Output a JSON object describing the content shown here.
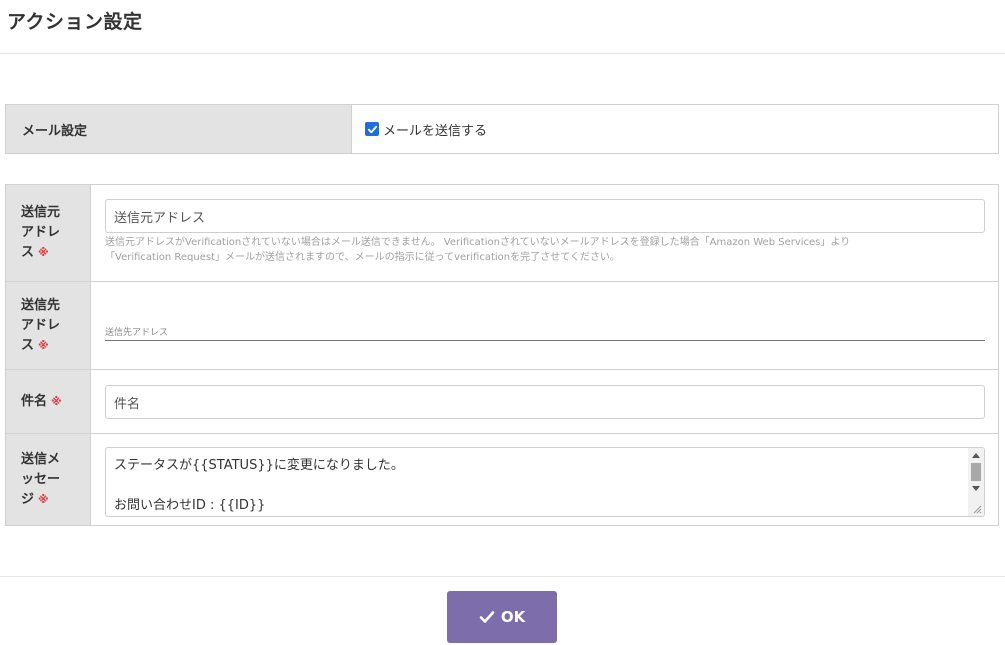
{
  "page": {
    "title": "アクション設定"
  },
  "mail_setting": {
    "label": "メール設定",
    "send_checkbox_label": "メールを送信する",
    "send_checked": true
  },
  "form": {
    "from_address": {
      "label_lines": [
        "送信元",
        "アドレ",
        "ス"
      ],
      "required_mark": "※",
      "placeholder": "送信元アドレス",
      "help_line1": "送信元アドレスがVerificationされていない場合はメール送信できません。 Verificationされていないメールアドレスを登録した場合「Amazon Web Services」より",
      "help_line2": "「Verification Request」メールが送信されますので、メールの指示に従ってverificationを完了させてください。"
    },
    "to_address": {
      "label_lines": [
        "送信先",
        "アドレ",
        "ス"
      ],
      "required_mark": "※",
      "placeholder": "送信先アドレス"
    },
    "subject": {
      "label_lines": [
        "件名"
      ],
      "required_mark": "※",
      "placeholder": "件名"
    },
    "message": {
      "label_lines": [
        "送信メ",
        "ッセー",
        "ジ"
      ],
      "required_mark": "※",
      "line1": "ステータスが{{STATUS}}に変更になりました。",
      "line2": "",
      "line3": "お問い合わせID : {{ID}}"
    }
  },
  "footer": {
    "ok_label": "OK"
  },
  "colors": {
    "accent": "#7d6dab",
    "required": "#e0343b",
    "checkbox": "#1f6fd6"
  }
}
